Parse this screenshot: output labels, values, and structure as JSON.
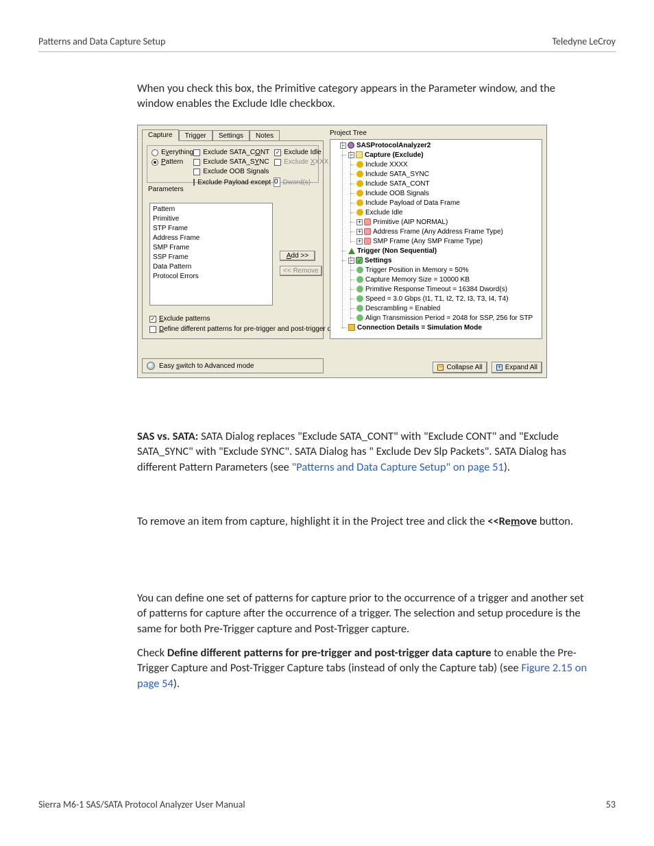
{
  "header": {
    "left": "Patterns and Data Capture Setup",
    "right": "Teledyne LeCroy"
  },
  "footer": {
    "left": "Sierra M6-1 SAS/SATA Protocol Analyzer User Manual",
    "right": "53"
  },
  "para1": "When you check this box, the Primitive category appears in the Parameter window, and the window enables the Exclude Idle checkbox.",
  "para2": {
    "lead": "SAS vs. SATA: ",
    "body1": "SATA Dialog replaces \"Exclude SATA_CONT\" with \"Exclude CONT\" and \"Exclude SATA_SYNC\" with \"Exclude SYNC\". SATA Dialog has \" Exclude Dev Slp Packets\". SATA Dialog has different Pattern Parameters (see ",
    "link": "\"Patterns and Data Capture Setup\" on page 51",
    "tail": ")."
  },
  "para3": {
    "a": "To remove an item from capture, highlight it in the Project tree and click the ",
    "b": "<<Re",
    "c": "m",
    "d": "ove",
    "e": " button."
  },
  "para4": "You can define one set of patterns for capture prior to the occurrence of a trigger and another set of patterns for capture after the occurrence of a trigger. The selection and setup procedure is the same for both Pre-Trigger capture and Post-Trigger capture.",
  "para5": {
    "a": "Check ",
    "b": "Define different patterns for pre-trigger and post-trigger data capture",
    "c": " to enable the Pre-Trigger Capture and Post-Trigger Capture tabs (instead of only the Capture tab) (see ",
    "link": "Figure 2.15 on page 54",
    "d": ")."
  },
  "shot": {
    "tabs": [
      "Capture",
      "Trigger",
      "Settings",
      "Notes"
    ],
    "radios": {
      "everything": {
        "label_pre": "E",
        "label_u": "v",
        "label_post": "erything",
        "selected": false
      },
      "pattern": {
        "label_pre": "",
        "label_u": "P",
        "label_post": "attern",
        "selected": true
      }
    },
    "checks": {
      "ex_cont": {
        "text_pre": "Exclude SATA_C",
        "text_u": "O",
        "text_post": "NT",
        "checked": false
      },
      "ex_sync": {
        "text_pre": "Exclude SATA_S",
        "text_u": "Y",
        "text_post": "NC",
        "checked": false
      },
      "ex_oob": {
        "text_pre": "Exclude OOB Signals",
        "text_u": "",
        "text_post": "",
        "checked": false
      },
      "ex_idle": {
        "text_pre": "Exclude Idle",
        "text_u": "",
        "text_post": "",
        "checked": true
      },
      "ex_xxxx": {
        "text_pre": "Exclude ",
        "text_u": "X",
        "text_post": "XXX",
        "checked": false,
        "disabled": true
      }
    },
    "payload": {
      "label": "Exclude Payload except",
      "value": "0",
      "unit": "Dword(s)"
    },
    "parameters_label": "Parameters",
    "param_list": [
      "Pattern",
      "Primitive",
      "STP Frame",
      "",
      "Address Frame",
      "",
      "SMP Frame",
      "SSP Frame",
      "Data Pattern",
      "",
      "Protocol Errors"
    ],
    "btn_add": {
      "pre": "",
      "u": "A",
      "post": "dd >>"
    },
    "btn_remove": "<< Remove",
    "exclude_patterns": {
      "text_pre": "",
      "text_u": "E",
      "text_post": "xclude patterns",
      "checked": true
    },
    "define_diff": {
      "text_pre": "",
      "text_u": "D",
      "text_post": "efine different patterns for pre-trigger and post-trigger data captures",
      "checked": false
    },
    "easy_link": {
      "pre": "Easy ",
      "u": "s",
      "post": "witch to Advanced mode"
    },
    "tree_label": "Project Tree",
    "tree": {
      "root": "SASProtocolAnalyzer2",
      "capture": {
        "label": "Capture (Exclude)",
        "items": [
          "Include XXXX",
          "Include SATA_SYNC",
          "Include SATA_CONT",
          "Include OOB Signals",
          "Include Payload of Data Frame",
          "Exclude Idle"
        ],
        "extra": [
          "Primitive (AIP NORMAL)",
          "Address Frame (Any Address Frame Type)",
          "SMP Frame (Any SMP Frame Type)"
        ]
      },
      "trigger": "Trigger (Non Sequential)",
      "settings": {
        "label": "Settings",
        "items": [
          "Trigger Position in Memory = 50%",
          "Capture Memory Size = 10000 KB",
          "Primitive Response Timeout = 16384 Dword(s)",
          "Speed = 3.0 Gbps (I1, T1, I2, T2, I3, T3, I4, T4)",
          "Descrambling = Enabled",
          "Align Transmission Period = 2048 for SSP, 256 for STP"
        ]
      },
      "conn": "Connection Details = Simulation Mode"
    },
    "collapse_btn": "Collapse All",
    "expand_btn": "Expand All"
  }
}
